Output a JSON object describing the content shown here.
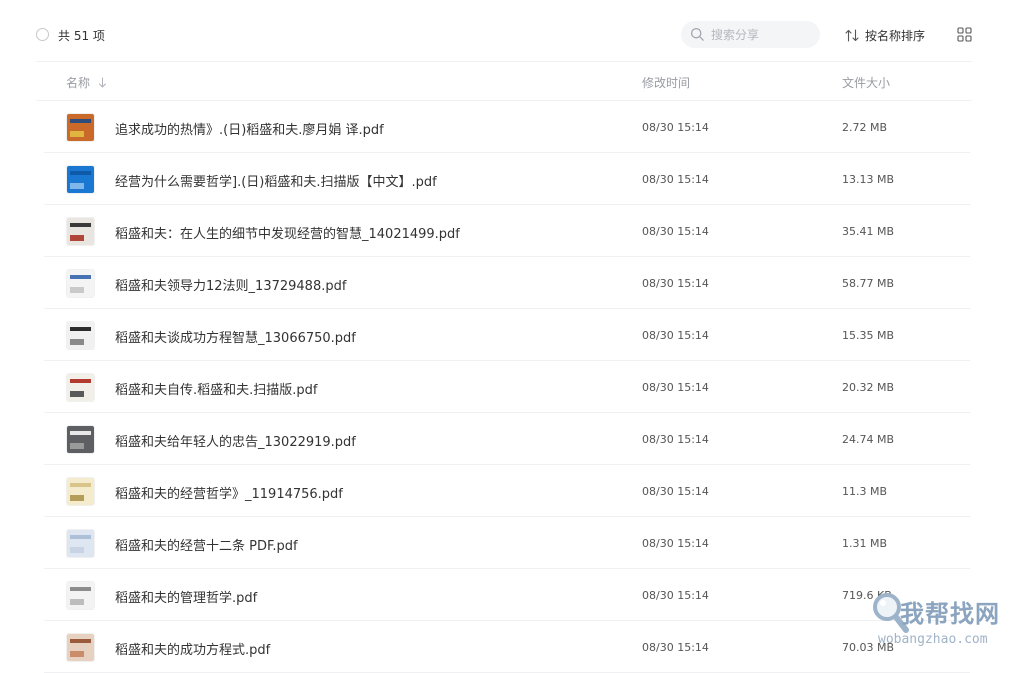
{
  "toolbar": {
    "count_label": "共 51 项",
    "search_placeholder": "搜索分享",
    "sort_label": "按名称排序"
  },
  "columns": {
    "name": "名称",
    "modified": "修改时间",
    "size": "文件大小"
  },
  "files": [
    {
      "name": "追求成功的热情》.(日)稻盛和夫.廖月娟 译.pdf",
      "modified": "08/30 15:14",
      "size": "2.72 MB",
      "thumb": [
        "#c96a2b",
        "#2f4d7a",
        "#e0b640"
      ]
    },
    {
      "name": "经营为什么需要哲学].(日)稻盛和夫.扫描版【中文】.pdf",
      "modified": "08/30 15:14",
      "size": "13.13 MB",
      "thumb": [
        "#1a78d2",
        "#0f5aa8",
        "#7fb7ea"
      ]
    },
    {
      "name": "稻盛和夫：在人生的细节中发现经营的智慧_14021499.pdf",
      "modified": "08/30 15:14",
      "size": "35.41 MB",
      "thumb": [
        "#e9e6e1",
        "#3a3a3a",
        "#b0463a"
      ]
    },
    {
      "name": "稻盛和夫领导力12法则_13729488.pdf",
      "modified": "08/30 15:14",
      "size": "58.77 MB",
      "thumb": [
        "#f4f4f4",
        "#4a73b5",
        "#c9c9c9"
      ]
    },
    {
      "name": "稻盛和夫谈成功方程智慧_13066750.pdf",
      "modified": "08/30 15:14",
      "size": "15.35 MB",
      "thumb": [
        "#f1f1f1",
        "#2b2b2b",
        "#8a8a8a"
      ]
    },
    {
      "name": "稻盛和夫自传.稻盛和夫.扫描版.pdf",
      "modified": "08/30 15:14",
      "size": "20.32 MB",
      "thumb": [
        "#f2efe9",
        "#b23a2e",
        "#5a5a5a"
      ]
    },
    {
      "name": "稻盛和夫给年轻人的忠告_13022919.pdf",
      "modified": "08/30 15:14",
      "size": "24.74 MB",
      "thumb": [
        "#5d5f63",
        "#e8e8e8",
        "#9a9a9a"
      ]
    },
    {
      "name": "稻盛和夫的经营哲学》_11914756.pdf",
      "modified": "08/30 15:14",
      "size": "11.3 MB",
      "thumb": [
        "#f5eccd",
        "#d9c48a",
        "#b59e5a"
      ]
    },
    {
      "name": "稻盛和夫的经营十二条 PDF.pdf",
      "modified": "08/30 15:14",
      "size": "1.31 MB",
      "thumb": [
        "#dde6f1",
        "#aec0d8",
        "#c8d4e4"
      ]
    },
    {
      "name": "稻盛和夫的管理哲学.pdf",
      "modified": "08/30 15:14",
      "size": "719.6 KB",
      "thumb": [
        "#f3f3f3",
        "#8c8c8c",
        "#bdbdbd"
      ]
    },
    {
      "name": "稻盛和夫的成功方程式.pdf",
      "modified": "08/30 15:14",
      "size": "70.03 MB",
      "thumb": [
        "#e7d2c2",
        "#9a5b3c",
        "#c98d6a"
      ]
    }
  ],
  "watermark": {
    "cn": "我帮找网",
    "en": "wobangzhao.com"
  }
}
